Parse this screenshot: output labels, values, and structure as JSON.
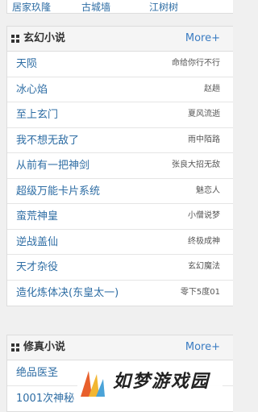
{
  "top_links": [
    "居家玖隆",
    "古城墙",
    "江树树"
  ],
  "sections": [
    {
      "title": "玄幻小说",
      "more": "More+",
      "items": [
        {
          "book": "天陨",
          "author": "命给你行不行"
        },
        {
          "book": "冰心焰",
          "author": "赵趟"
        },
        {
          "book": "至上玄门",
          "author": "夏风流逝"
        },
        {
          "book": "我不想无敌了",
          "author": "雨中陌路"
        },
        {
          "book": "从前有一把神剑",
          "author": "张良大招无敌"
        },
        {
          "book": "超级万能卡片系统",
          "author": "魅恋人"
        },
        {
          "book": "蛮荒神皇",
          "author": "小僧说梦"
        },
        {
          "book": "逆战盖仙",
          "author": "终极成神"
        },
        {
          "book": "天才杂役",
          "author": "玄幻魔法"
        },
        {
          "book": "造化炼体决(东皇太一)",
          "author": "零下5度01"
        }
      ]
    },
    {
      "title": "修真小说",
      "more": "More+",
      "items": [
        {
          "book": "绝品医圣",
          "author": ""
        },
        {
          "book": "1001次神秘",
          "author": ""
        }
      ]
    }
  ],
  "watermark": {
    "text": "如梦游戏园"
  },
  "colors": {
    "link": "#2e6da4",
    "more": "#3a7cc2",
    "header_bg": "#f5f5f5",
    "border": "#dddddd",
    "page_bg": "#f0f0f0"
  }
}
